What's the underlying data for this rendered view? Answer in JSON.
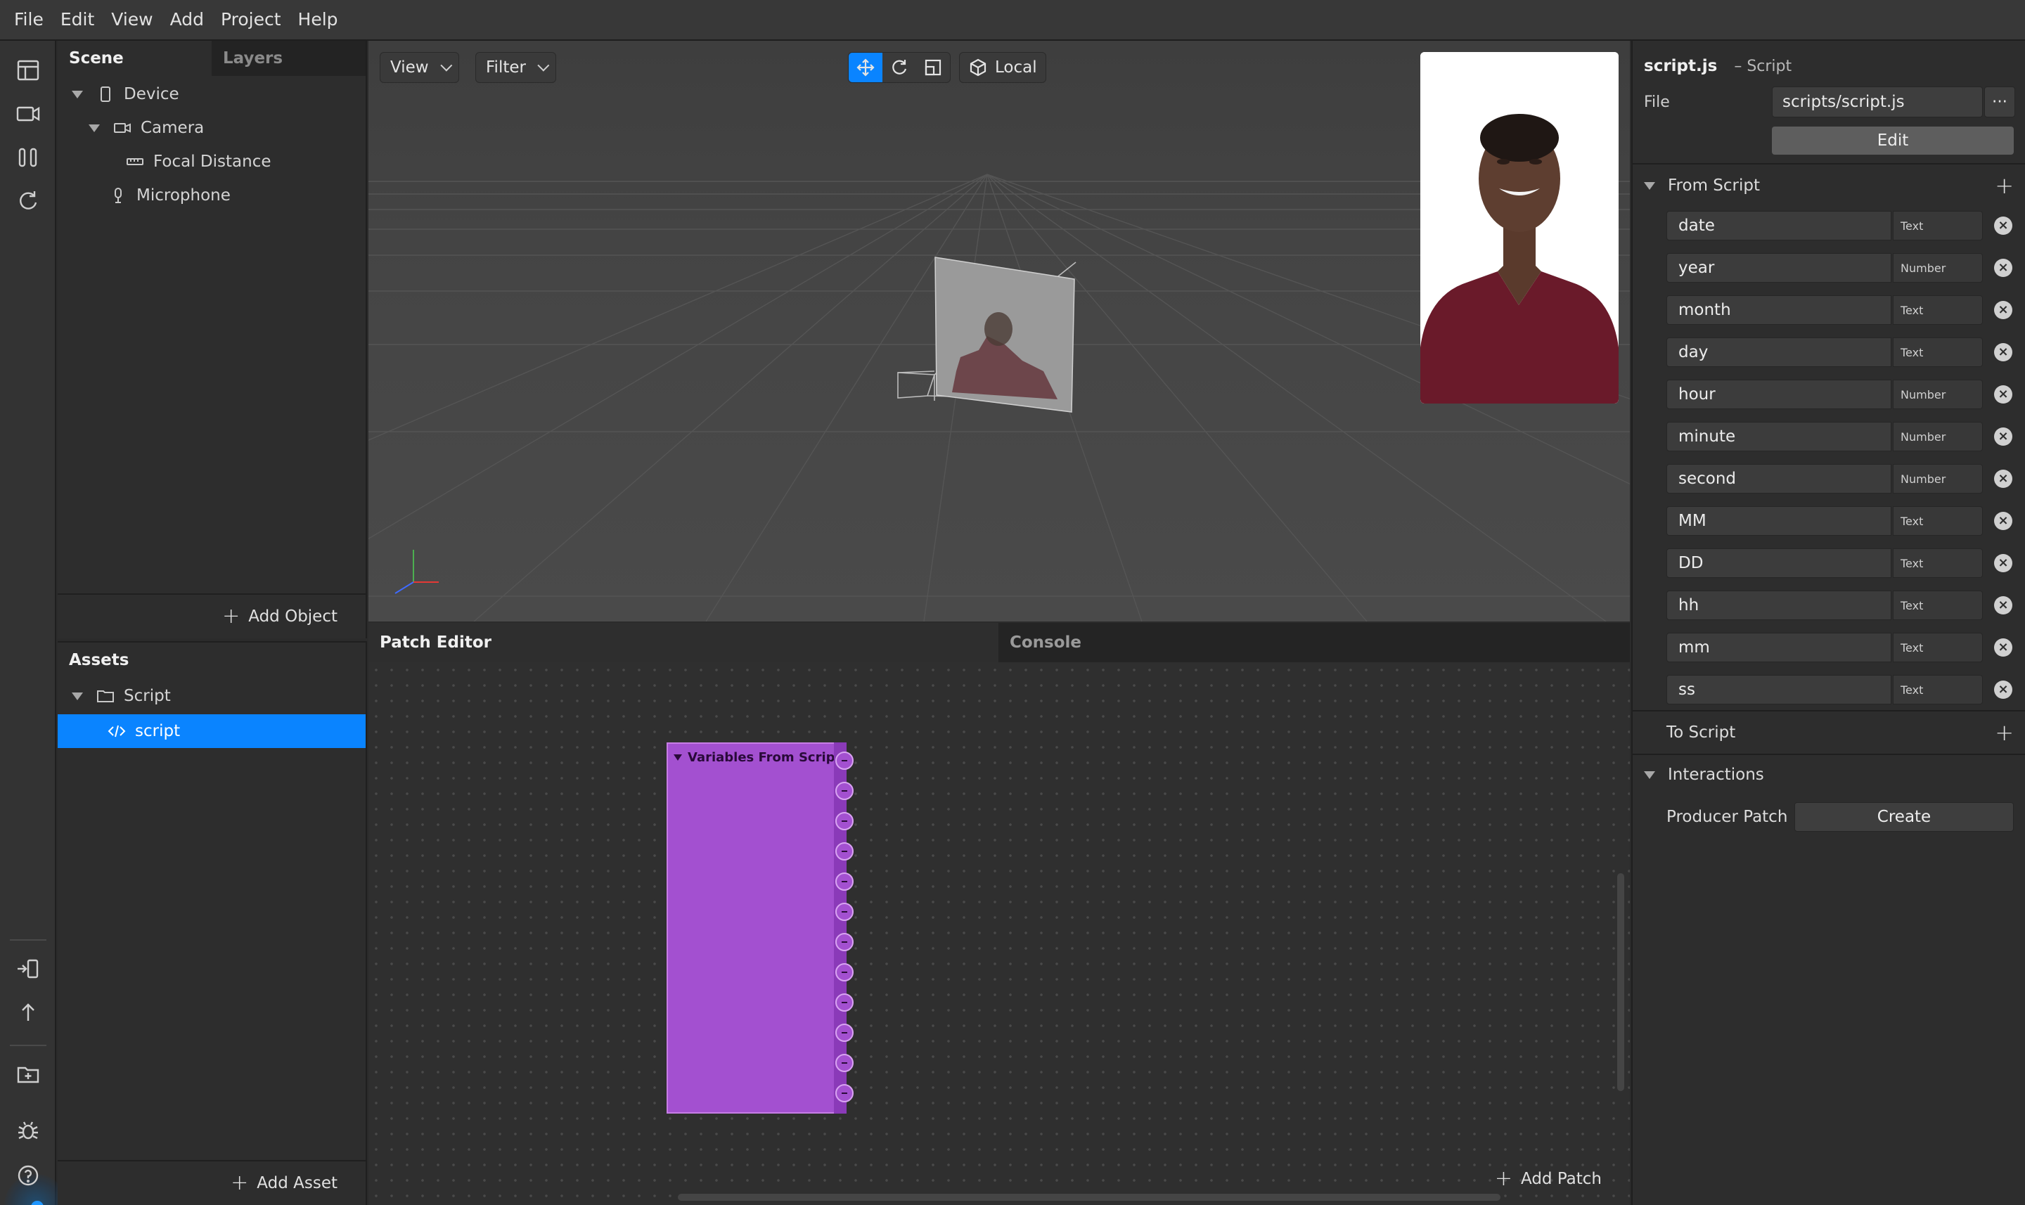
{
  "menu": [
    "File",
    "Edit",
    "View",
    "Add",
    "Project",
    "Help"
  ],
  "scene_panel": {
    "tabs": [
      "Scene",
      "Layers"
    ],
    "tree": [
      {
        "label": "Device",
        "icon": "phone-icon"
      },
      {
        "label": "Camera",
        "icon": "camera-icon"
      },
      {
        "label": "Focal Distance",
        "icon": "ruler-icon"
      },
      {
        "label": "Microphone",
        "icon": "microphone-icon"
      }
    ],
    "add_label": "Add Object"
  },
  "assets_panel": {
    "title": "Assets",
    "tree": [
      {
        "label": "Script",
        "icon": "folder-icon"
      },
      {
        "label": "script",
        "icon": "code-icon",
        "selected": true
      }
    ],
    "add_label": "Add Asset"
  },
  "viewport": {
    "view_label": "View",
    "filter_label": "Filter",
    "space_label": "Local",
    "active_tool": "move-tool"
  },
  "patch_editor": {
    "tabs": [
      "Patch Editor",
      "Console"
    ],
    "node_title": "Variables From Script",
    "port_count": 12,
    "add_label": "Add Patch"
  },
  "inspector": {
    "file_name": "script.js",
    "file_kind": "– Script",
    "file_label": "File",
    "file_path": "scripts/script.js",
    "more_label": "···",
    "edit_label": "Edit",
    "from_script_label": "From Script",
    "variables": [
      {
        "name": "date",
        "type": "Text"
      },
      {
        "name": "year",
        "type": "Number"
      },
      {
        "name": "month",
        "type": "Text"
      },
      {
        "name": "day",
        "type": "Text"
      },
      {
        "name": "hour",
        "type": "Number"
      },
      {
        "name": "minute",
        "type": "Number"
      },
      {
        "name": "second",
        "type": "Number"
      },
      {
        "name": "MM",
        "type": "Text"
      },
      {
        "name": "DD",
        "type": "Text"
      },
      {
        "name": "hh",
        "type": "Text"
      },
      {
        "name": "mm",
        "type": "Text"
      },
      {
        "name": "ss",
        "type": "Text"
      }
    ],
    "to_script_label": "To Script",
    "interactions_label": "Interactions",
    "producer_patch_label": "Producer Patch",
    "create_label": "Create"
  },
  "colors": {
    "accent": "#0a84ff",
    "patch_node": "#a350d0",
    "panel_bg": "#2d2d2d"
  }
}
